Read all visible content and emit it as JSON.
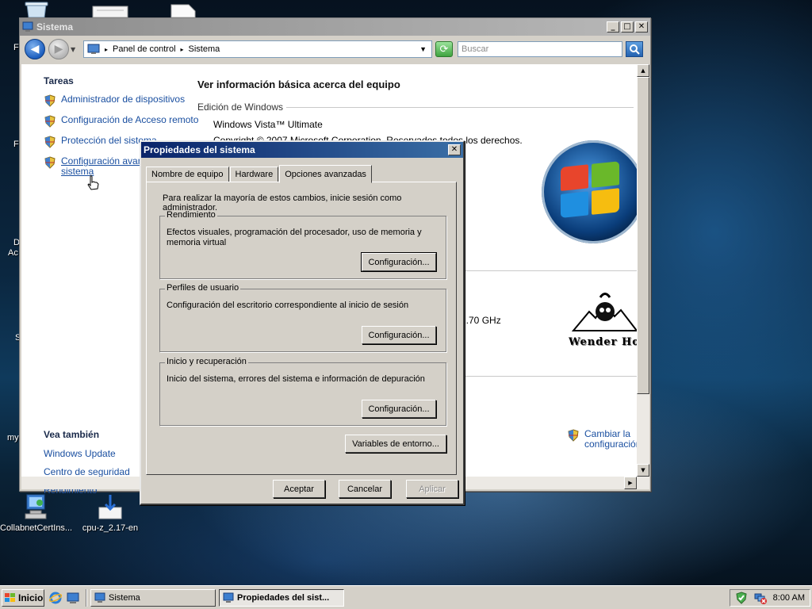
{
  "desktop": {
    "icons": [
      {
        "label": "CollabnetCertIns...",
        "icon": "installer-icon"
      },
      {
        "label": "cpu-z_2.17-en",
        "icon": "download-icon"
      }
    ],
    "peek_labels": [
      "F",
      "F",
      "D",
      "Ac",
      "S",
      "my"
    ]
  },
  "main_window": {
    "title": "Sistema",
    "address": {
      "crumbs": [
        "Panel de control",
        "Sistema"
      ]
    },
    "search_placeholder": "Buscar",
    "tasks_heading": "Tareas",
    "tasks": [
      {
        "label": "Administrador de dispositivos"
      },
      {
        "label": "Configuración de Acceso remoto"
      },
      {
        "label": "Protección del sistema"
      },
      {
        "label_line1": "Configuración avanzada d",
        "label_line2": "sistema"
      }
    ],
    "see_also_heading": "Vea también",
    "see_also": [
      "Windows Update",
      "Centro de seguridad",
      "Rendimiento"
    ],
    "heading": "Ver información básica acerca del equipo",
    "edition_group": "Edición de Windows",
    "edition_name": "Windows Vista™ Ultimate",
    "copyright_fragment": "Copyright © 2007 Microsoft Corporation. Reservados todos los derechos.",
    "cpu_fragment": "2.70 GHz",
    "brand_text": "Wender Ho",
    "change_settings": [
      "Cambiar la",
      "configuración"
    ]
  },
  "dialog": {
    "title": "Propiedades del sistema",
    "tabs": [
      "Nombre de equipo",
      "Hardware",
      "Opciones avanzadas"
    ],
    "active_tab": "Opciones avanzadas",
    "intro": "Para realizar la mayoría de estos cambios, inicie sesión como administrador.",
    "groups": [
      {
        "legend": "Rendimiento",
        "description": "Efectos visuales, programación del procesador, uso de memoria y memoria virtual",
        "button": "Configuración..."
      },
      {
        "legend": "Perfiles de usuario",
        "description": "Configuración del escritorio correspondiente al inicio de sesión",
        "button": "Configuración..."
      },
      {
        "legend": "Inicio y recuperación",
        "description": "Inicio del sistema, errores del sistema e información de depuración",
        "button": "Configuración..."
      }
    ],
    "env_button": "Variables de entorno...",
    "ok": "Aceptar",
    "cancel": "Cancelar",
    "apply": "Aplicar"
  },
  "taskbar": {
    "start_label": "Inicio",
    "tasks": [
      {
        "label": "Sistema",
        "active": false
      },
      {
        "label": "Propiedades del sist...",
        "active": true
      }
    ],
    "clock": "8:00 AM"
  },
  "colors": {
    "link": "#1a4fa0",
    "dialog_title_start": "#0a246a",
    "dialog_title_end": "#3a6ea5",
    "inactive_title": "#8c8c8c",
    "face": "#d4d0c8"
  }
}
